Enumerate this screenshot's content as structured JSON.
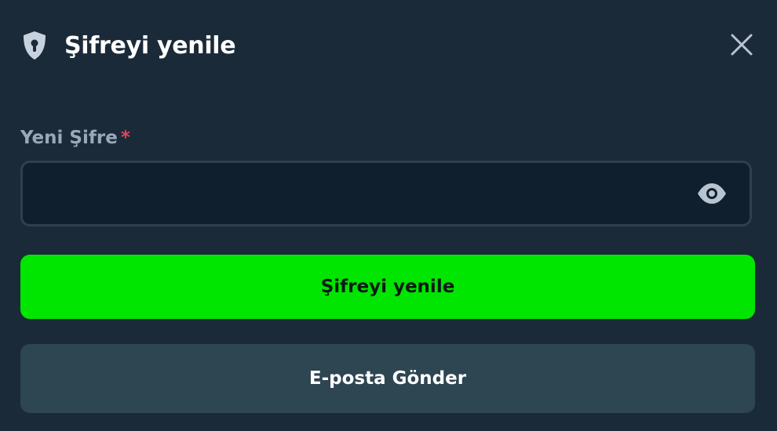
{
  "header": {
    "title": "Şifreyi yenile",
    "icon": "shield-lock-icon",
    "close_icon": "close-icon"
  },
  "form": {
    "password_label": "Yeni Şifre",
    "required_mark": "*",
    "password_value": "",
    "password_placeholder": "",
    "visibility_icon": "eye-icon"
  },
  "actions": {
    "primary_label": "Şifreyi yenile",
    "secondary_label": "E-posta Gönder"
  },
  "colors": {
    "background": "#1b2a38",
    "primary": "#00e600",
    "required": "#e2455c",
    "secondary_button": "#2e4552"
  }
}
